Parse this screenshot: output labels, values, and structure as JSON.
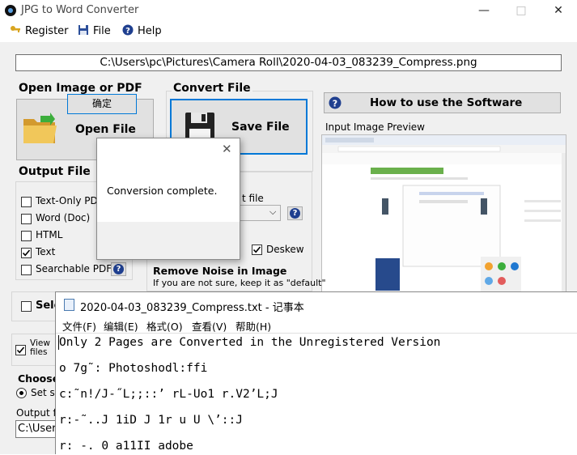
{
  "window": {
    "title": "JPG to Word Converter"
  },
  "menu": {
    "register": "Register",
    "file": "File",
    "help": "Help"
  },
  "file_path": "C:\\Users\\pc\\Pictures\\Camera Roll\\2020-04-03_083239_Compress.png",
  "open_group": {
    "title": "Open Image or PDF",
    "button": "Open File"
  },
  "convert_group": {
    "title": "Convert File",
    "button": "Save File"
  },
  "howto_button": "How to use the Software",
  "preview_label": "Input Image Preview",
  "output_group": {
    "title": "Output File",
    "options": [
      {
        "label": "Text-Only PDF",
        "checked": false
      },
      {
        "label": "Word (Doc)",
        "checked": false
      },
      {
        "label": "HTML",
        "checked": false
      },
      {
        "label": "Text",
        "checked": true
      },
      {
        "label": "Searchable PDF",
        "checked": false
      }
    ]
  },
  "partial": {
    "file_suffix": "t file",
    "deskew_label": "Deskew",
    "deskew_checked": true,
    "remove_noise_title": "Remove Noise in Image",
    "remove_noise_hint": "If you are not sure, keep it as \"default\"",
    "select_fragment": "Sele",
    "view_files_line1": "View",
    "view_files_line2": "files",
    "choose_title": "Choose",
    "set_same_fragment": "Set sa",
    "output_folder_fragment": "Output f",
    "output_path_fragment": "C:\\User"
  },
  "dialog": {
    "message": "Conversion complete.",
    "ok": "确定"
  },
  "notepad": {
    "title": "2020-04-03_083239_Compress.txt - 记事本",
    "menu": [
      "文件(F)",
      "编辑(E)",
      "格式(O)",
      "查看(V)",
      "帮助(H)"
    ],
    "lines": [
      "Only 2 Pages are Converted in the Unregistered Version",
      "o 7g˜: Photoshodl:ffi",
      "c:˜n!/J-˝L;;::’ rL-Uo1 r.V2’L;J",
      "r:-˜..J 1iD J 1r u U \\’::J",
      "r: -. 0 a11II adobe"
    ]
  },
  "colors": {
    "focus_border": "#0078d7",
    "help_icon": "#1f3f8f",
    "folder_yellow": "#e8b84a"
  }
}
